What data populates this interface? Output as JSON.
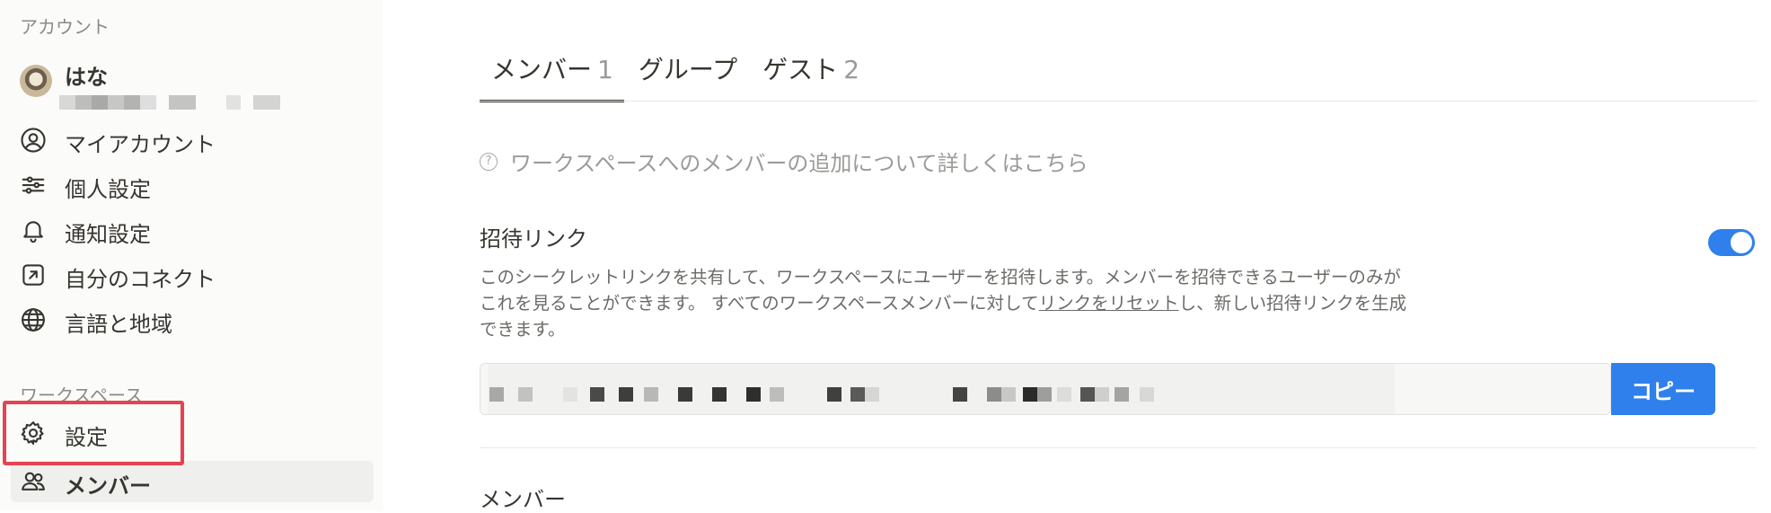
{
  "sidebar": {
    "account_section": "アカウント",
    "user_name": "はな",
    "account_items": [
      {
        "label": "マイアカウント",
        "icon": "user-circle-icon"
      },
      {
        "label": "個人設定",
        "icon": "sliders-icon"
      },
      {
        "label": "通知設定",
        "icon": "bell-icon"
      },
      {
        "label": "自分のコネクト",
        "icon": "arrow-square-icon"
      },
      {
        "label": "言語と地域",
        "icon": "globe-icon"
      }
    ],
    "workspace_section": "ワークスペース",
    "workspace_items": [
      {
        "label": "設定",
        "icon": "gear-icon"
      },
      {
        "label": "メンバー",
        "icon": "people-icon",
        "active": true
      }
    ]
  },
  "tabs": [
    {
      "label": "メンバー",
      "count": "1",
      "active": true
    },
    {
      "label": "グループ",
      "count": ""
    },
    {
      "label": "ゲスト",
      "count": "2"
    }
  ],
  "help_text": "ワークスペースへのメンバーの追加について詳しくはこちら",
  "invite": {
    "title": "招待リンク",
    "desc_line1": "このシークレットリンクを共有して、ワークスペースにユーザーを招待します。メンバーを招待できるユーザーのみが",
    "desc_line2_pre": "これを見ることができます。 すべてのワークスペースメンバーに対して",
    "reset_link": "リンクをリセット",
    "desc_line2_post": "し、新しい招待リンクを生成",
    "desc_line3": "できます。",
    "toggle_on": true,
    "copy_label": "コピー"
  },
  "members_title": "メンバー",
  "colors": {
    "accent": "#2f80ed",
    "highlight": "#e5434f",
    "sidebar_bg": "#fbfbfa"
  }
}
